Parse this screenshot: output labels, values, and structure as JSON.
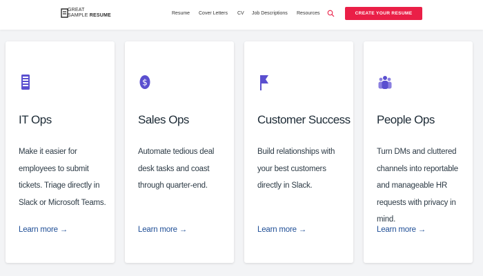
{
  "header": {
    "logo": {
      "line1": "Great",
      "line2_a": "Sample",
      "line2_b": "Resume"
    },
    "nav": [
      "Resume",
      "Cover Letters",
      "CV",
      "Job Descriptions",
      "Resources"
    ],
    "search_icon": "search-icon",
    "cta_label": "Create your resume",
    "cta_color": "#ea1f47"
  },
  "cards": [
    {
      "icon": "server-stack-icon",
      "title": "IT Ops",
      "description": "Make it easier for employees to submit tickets. Triage directly in Slack or Microsoft Teams.",
      "link": "Learn more →"
    },
    {
      "icon": "dollar-circle-icon",
      "title": "Sales Ops",
      "description": "Automate tedious deal desk tasks and coast through quarter-end.",
      "link": "Learn more →"
    },
    {
      "icon": "flag-icon",
      "title": "Customer Success",
      "description": "Build relationships with your best customers directly in Slack.",
      "link": "Learn more →"
    },
    {
      "icon": "people-group-icon",
      "title": "People Ops",
      "description": "Turn DMs and cluttered channels into reportable and manageable HR requests with privacy in mind.",
      "link": "Learn more →"
    }
  ],
  "colors": {
    "icon_purple": "#5a4fcf",
    "link_blue": "#1f4e96"
  }
}
